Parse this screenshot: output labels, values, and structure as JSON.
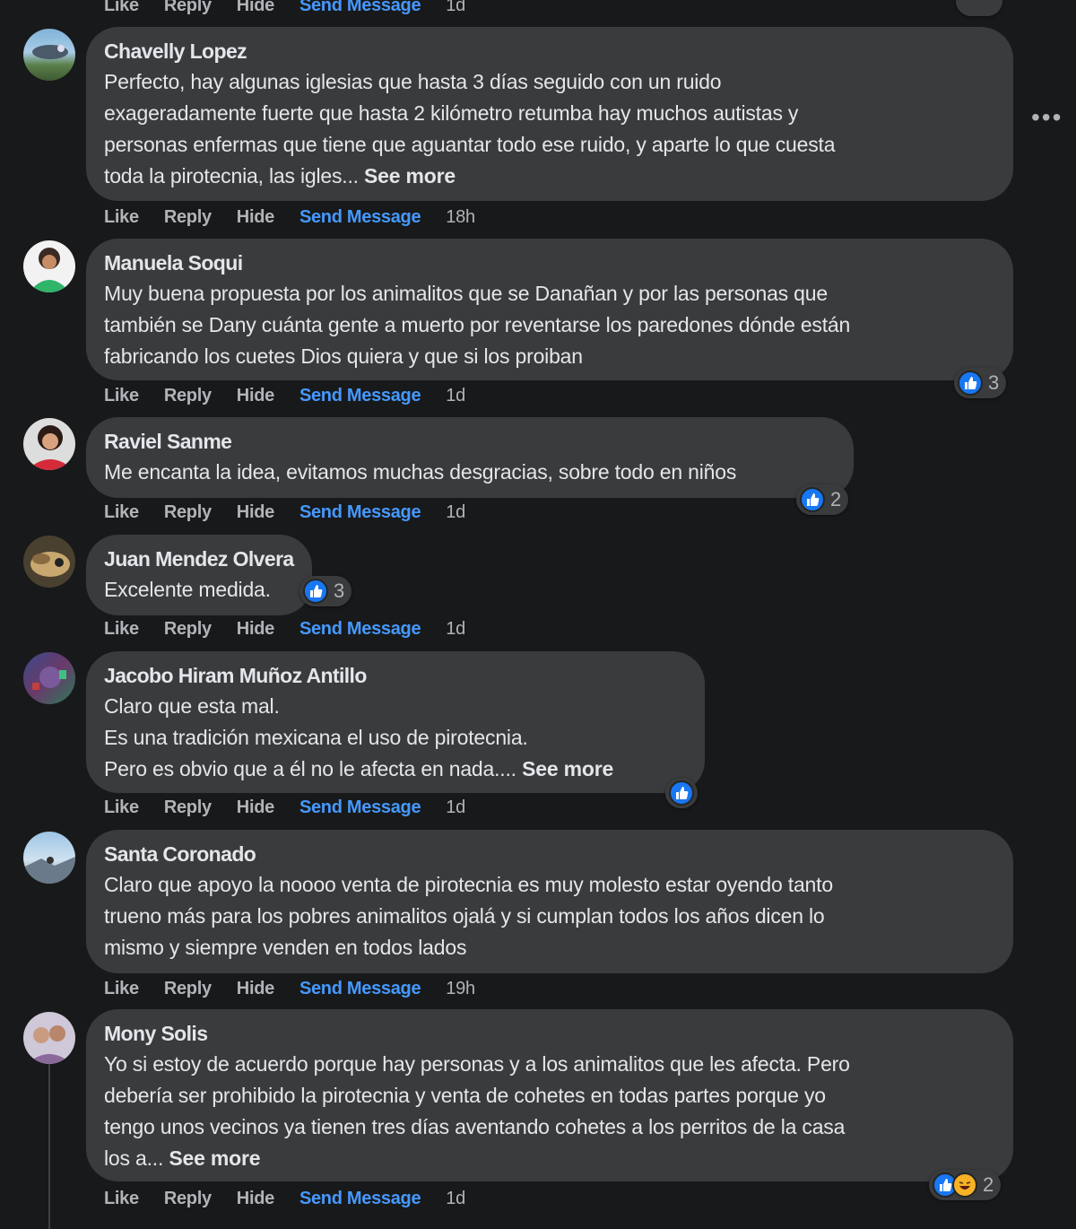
{
  "actions": {
    "like": "Like",
    "reply": "Reply",
    "hide": "Hide",
    "send_message": "Send Message"
  },
  "top_row": {
    "time": "1d"
  },
  "comments": [
    {
      "author": "Chavelly Lopez",
      "lines": [
        "Perfecto, hay algunas iglesias que hasta 3 días seguido con un ruido",
        "exageradamente fuerte que hasta 2 kilómetro retumba hay muchos autistas y",
        "personas enfermas que tiene que aguantar todo ese ruido, y aparte lo que cuesta",
        "toda la pirotecnia, las igles..."
      ],
      "see_more": "See more",
      "time": "18h"
    },
    {
      "author": "Manuela Soqui",
      "lines": [
        "Muy buena propuesta por los animalitos que se Danañan y por las personas que",
        "también se Dany cuánta gente a muerto por reventarse los paredones dónde están",
        "fabricando los cuetes Dios quiera y que si los proiban"
      ],
      "time": "1d",
      "reaction_count": "3"
    },
    {
      "author": "Raviel Sanme",
      "lines": [
        "Me encanta la idea, evitamos muchas desgracias, sobre todo en niños"
      ],
      "time": "1d",
      "reaction_count": "2"
    },
    {
      "author": "Juan Mendez Olvera",
      "lines": [
        "Excelente medida."
      ],
      "time": "1d",
      "reaction_count": "3"
    },
    {
      "author": "Jacobo Hiram Muñoz Antillo",
      "lines": [
        "Claro que esta mal.",
        "Es una tradición mexicana el uso de pirotecnia.",
        "Pero es obvio que a él no le afecta en nada...."
      ],
      "see_more": "See more",
      "time": "1d"
    },
    {
      "author": "Santa Coronado",
      "lines": [
        "Claro que apoyo la noooo venta de pirotecnia es muy molesto estar oyendo tanto",
        "trueno más para los pobres animalitos ojalá y si cumplan todos los años dicen lo",
        "mismo y siempre venden en todos lados"
      ],
      "time": "19h"
    },
    {
      "author": "Mony Solis",
      "lines": [
        "Yo si estoy de acuerdo porque hay personas y a los animalitos que les afecta. Pero",
        "debería ser prohibido la pirotecnia y venta de cohetes en todas partes porque yo",
        "tengo unos vecinos ya tienen tres días aventando cohetes a los perritos de la casa",
        "los a..."
      ],
      "see_more": "See more",
      "time": "1d",
      "reaction_count": "2"
    }
  ],
  "icons": {
    "like": "thumbs-up-icon",
    "haha": "laughing-face-icon",
    "more": "more-options-icon"
  },
  "colors": {
    "background": "#18191a",
    "bubble": "#3a3b3c",
    "link": "#4599ff",
    "like_blue": "#1877f2"
  }
}
